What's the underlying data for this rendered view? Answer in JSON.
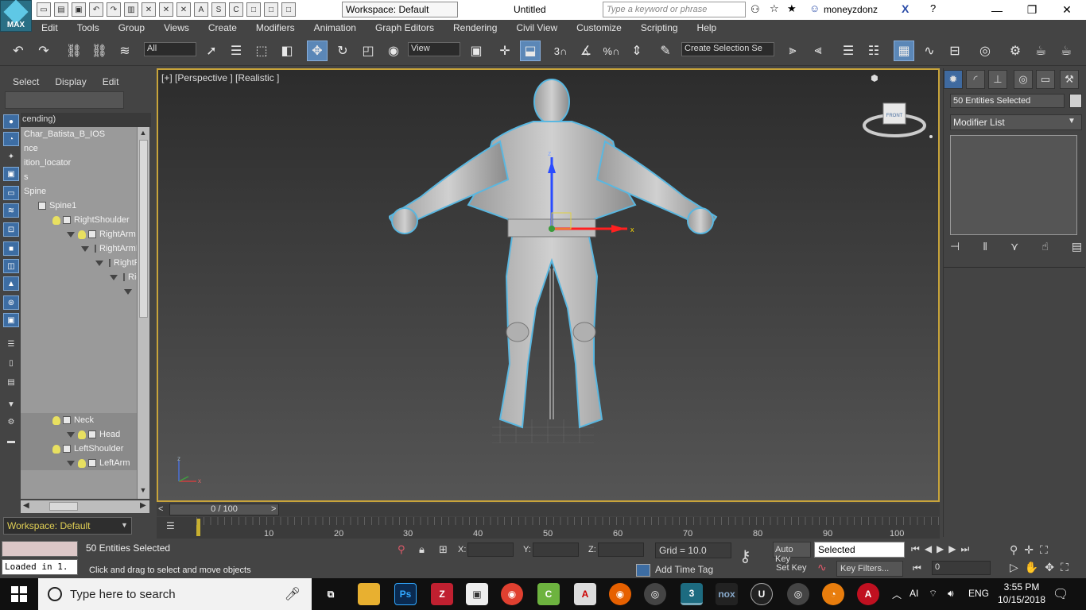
{
  "app": {
    "logo_label": "MAX",
    "workspace": "Workspace: Default",
    "document_title": "Untitled",
    "search_placeholder": "Type a keyword or phrase",
    "user": "moneyzdonz"
  },
  "menu": [
    "Edit",
    "Tools",
    "Group",
    "Views",
    "Create",
    "Modifiers",
    "Animation",
    "Graph Editors",
    "Rendering",
    "Civil View",
    "Customize",
    "Scripting",
    "Help"
  ],
  "toolbar": {
    "filter_value": "All",
    "ref_coord_value": "View",
    "snap_labels": [
      "3",
      "%"
    ],
    "selection_set_placeholder": "Create Selection Se"
  },
  "explorer": {
    "tabs": [
      "Select",
      "Display",
      "Edit"
    ],
    "header": "cending)",
    "tree": [
      {
        "label": "Char_Batista_B_IOS",
        "indent": 0
      },
      {
        "label": "nce",
        "indent": 0
      },
      {
        "label": "ition_locator",
        "indent": 0
      },
      {
        "label": "s",
        "indent": 0
      },
      {
        "label": "Spine",
        "indent": 0
      },
      {
        "label": "Spine1",
        "indent": 1
      },
      {
        "label": "RightShoulder",
        "indent": 2
      },
      {
        "label": "RightArm",
        "indent": 3
      },
      {
        "label": "RightArmRoll",
        "indent": 4
      },
      {
        "label": "RightForeA",
        "indent": 5
      },
      {
        "label": "RightFo",
        "indent": 6
      },
      {
        "label": "Rig",
        "indent": 7
      },
      {
        "label": "",
        "indent": 8
      },
      {
        "label": "",
        "indent": 8
      },
      {
        "label": "",
        "indent": 9
      },
      {
        "label": "",
        "indent": 9
      },
      {
        "label": "",
        "indent": 8
      },
      {
        "label": "",
        "indent": 9
      },
      {
        "label": "",
        "indent": 8
      },
      {
        "label": "",
        "indent": 9
      },
      {
        "label": "Neck",
        "indent": 2
      },
      {
        "label": "Head",
        "indent": 3
      },
      {
        "label": "LeftShoulder",
        "indent": 2
      },
      {
        "label": "LeftArm",
        "indent": 3
      }
    ],
    "workspace": "Workspace: Default"
  },
  "viewport": {
    "label": "[+] [Perspective ] [Realistic ]",
    "axis_x": "x",
    "axis_z": "z",
    "viewcube_label": "FRONT"
  },
  "timeline": {
    "slider_text": "0 / 100",
    "ticks": [
      "10",
      "20",
      "30",
      "40",
      "50",
      "60",
      "70",
      "80",
      "90",
      "100"
    ]
  },
  "status": {
    "maxscript_output": "Loaded in 1.",
    "selection": "50 Entities Selected",
    "prompt": "Click and drag to select and move objects",
    "x_label": "X:",
    "y_label": "Y:",
    "z_label": "Z:",
    "grid": "Grid = 10.0",
    "add_time_tag": "Add Time Tag",
    "auto_key": "Auto Key",
    "set_key": "Set Key",
    "key_mode": "Selected",
    "key_filters": "Key Filters...",
    "frame": "0"
  },
  "command_panel": {
    "object_name": "50 Entities Selected",
    "modifier_list": "Modifier List"
  },
  "taskbar": {
    "search_placeholder": "Type here to search",
    "language": "ENG",
    "time": "3:55 PM",
    "date": "10/15/2018"
  },
  "colors": {
    "viewport_border": "#c8a43a",
    "accent_blue": "#5b87b7",
    "workspace_text": "#e0cf55"
  }
}
